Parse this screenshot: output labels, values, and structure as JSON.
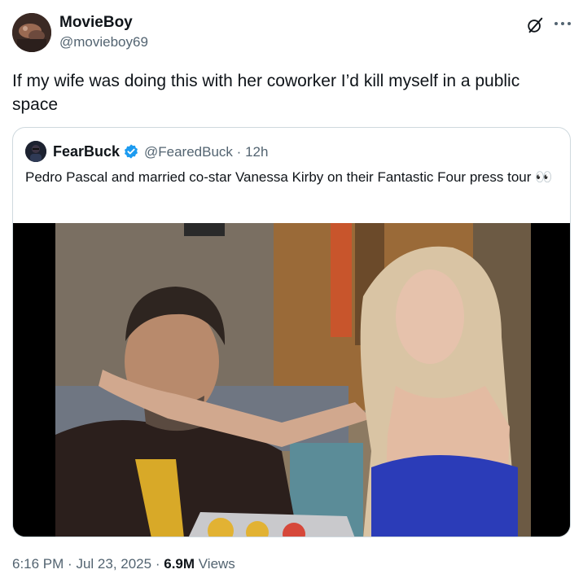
{
  "author": {
    "name": "MovieBoy",
    "handle": "@movieboy69"
  },
  "tweet_text": "If my wife was doing this with her coworker I’d kill myself in a public space",
  "quoted": {
    "author_name": "FearBuck",
    "handle": "@FearedBuck",
    "separator": "·",
    "time": "12h",
    "text": "Pedro Pascal and married co-star Vanessa Kirby on their Fantastic Four press tour 👀",
    "verified_color": "#1d9bf0"
  },
  "footer": {
    "time": "6:16 PM",
    "separator": "·",
    "date": "Jul 23, 2025",
    "views_count": "6.9M",
    "views_label": "Views"
  },
  "icons": [
    "grok-icon",
    "more-icon",
    "verified-badge-icon"
  ],
  "colors": {
    "text": "#0f1419",
    "secondary": "#536471",
    "border": "#cfd9de"
  }
}
